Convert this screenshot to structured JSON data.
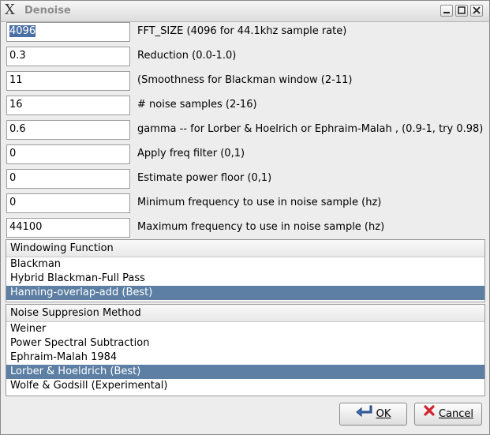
{
  "window": {
    "title": "Denoise"
  },
  "fields": [
    {
      "value": "4096",
      "label": "FFT_SIZE (4096 for 44.1khz sample rate)"
    },
    {
      "value": "0.3",
      "label": "Reduction (0.0-1.0)"
    },
    {
      "value": "11",
      "label": "(Smoothness for Blackman window (2-11)"
    },
    {
      "value": "16",
      "label": "# noise samples (2-16)"
    },
    {
      "value": "0.6",
      "label": "gamma -- for Lorber & Hoelrich or Ephraim-Malah , (0.9-1, try 0.98)"
    },
    {
      "value": "0",
      "label": "Apply freq filter (0,1)"
    },
    {
      "value": "0",
      "label": "Estimate power floor (0,1)"
    },
    {
      "value": "0",
      "label": "Minimum frequency to use in noise sample (hz)"
    },
    {
      "value": "44100",
      "label": "Maximum frequency to use in noise sample (hz)"
    }
  ],
  "windowing": {
    "header": "Windowing Function",
    "items": [
      "Blackman",
      "Hybrid Blackman-Full Pass",
      "Hanning-overlap-add (Best)"
    ],
    "selected": "Hanning-overlap-add (Best)"
  },
  "suppression": {
    "header": "Noise Suppresion Method",
    "items": [
      "Weiner",
      "Power Spectral Subtraction",
      "Ephraim-Malah 1984",
      "Lorber & Hoeldrich (Best)",
      "Wolfe & Godsill (Experimental)"
    ],
    "selected": "Lorber & Hoeldrich (Best)"
  },
  "buttons": {
    "ok": "OK",
    "cancel": "Cancel"
  },
  "colors": {
    "selection": "#5c7fa3",
    "cancel_icon": "#d0252a",
    "ok_icon": "#3d6fb8"
  }
}
